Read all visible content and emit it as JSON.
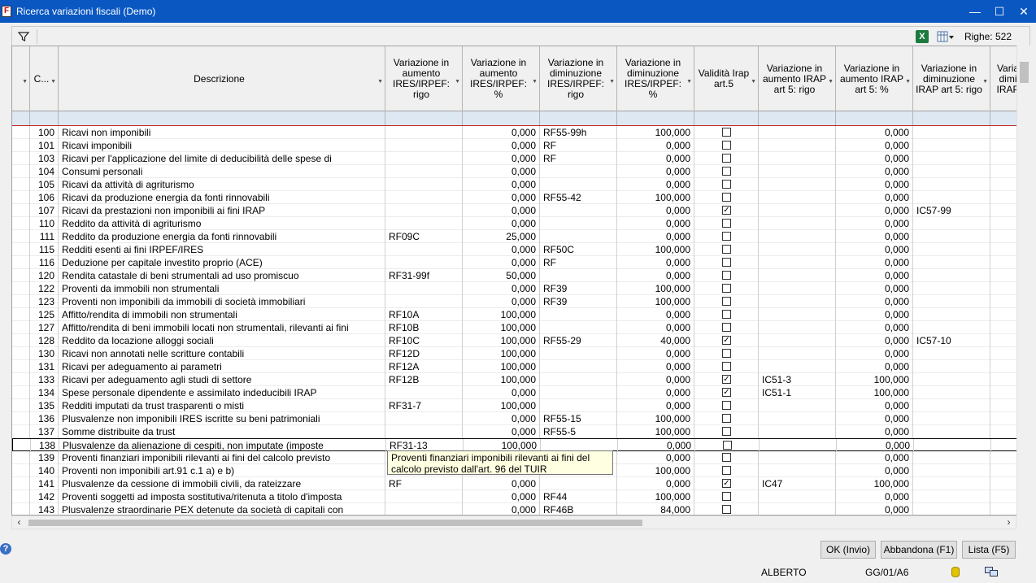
{
  "window": {
    "title": "Ricerca variazioni fiscali  (Demo)",
    "app_icon_glyph": "F"
  },
  "toolbar": {
    "rows_label": "Righe: 522"
  },
  "columns": [
    {
      "key": "sel",
      "label": ""
    },
    {
      "key": "code",
      "label": "C..."
    },
    {
      "key": "desc",
      "label": "Descrizione"
    },
    {
      "key": "va_ires_rigo",
      "label": "Variazione in aumento IRES/IRPEF: rigo"
    },
    {
      "key": "va_ires_pct",
      "label": "Variazione in aumento IRES/IRPEF: %"
    },
    {
      "key": "vd_ires_rigo",
      "label": "Variazione in diminuzione IRES/IRPEF: rigo"
    },
    {
      "key": "vd_ires_pct",
      "label": "Variazione in diminuzione IRES/IRPEF: %"
    },
    {
      "key": "irap",
      "label": "Validità Irap art.5"
    },
    {
      "key": "va_irap_rigo",
      "label": "Variazione in aumento IRAP art 5: rigo"
    },
    {
      "key": "va_irap_pct",
      "label": "Variazione in aumento IRAP art 5: %"
    },
    {
      "key": "vd_irap_rigo",
      "label": "Variazione in diminuzione IRAP art 5: rigo"
    },
    {
      "key": "vd_irap_more",
      "label": "Varia dimi IRAP"
    }
  ],
  "rows": [
    {
      "code": "100",
      "desc": "Ricavi non imponibili",
      "a": "",
      "b": "0,000",
      "c": "RF55-99h",
      "d": "100,000",
      "irap": false,
      "e": "",
      "f": "0,000",
      "g": ""
    },
    {
      "code": "101",
      "desc": "Ricavi imponibili",
      "a": "",
      "b": "0,000",
      "c": "RF",
      "d": "0,000",
      "irap": false,
      "e": "",
      "f": "0,000",
      "g": ""
    },
    {
      "code": "103",
      "desc": "Ricavi per l'applicazione del limite di deducibilità delle spese di",
      "a": "",
      "b": "0,000",
      "c": "RF",
      "d": "0,000",
      "irap": false,
      "e": "",
      "f": "0,000",
      "g": ""
    },
    {
      "code": "104",
      "desc": "Consumi personali",
      "a": "",
      "b": "0,000",
      "c": "",
      "d": "0,000",
      "irap": false,
      "e": "",
      "f": "0,000",
      "g": ""
    },
    {
      "code": "105",
      "desc": "Ricavi da attività di agriturismo",
      "a": "",
      "b": "0,000",
      "c": "",
      "d": "0,000",
      "irap": false,
      "e": "",
      "f": "0,000",
      "g": ""
    },
    {
      "code": "106",
      "desc": "Ricavi da produzione energia da fonti rinnovabili",
      "a": "",
      "b": "0,000",
      "c": "RF55-42",
      "d": "100,000",
      "irap": false,
      "e": "",
      "f": "0,000",
      "g": ""
    },
    {
      "code": "107",
      "desc": "Ricavi da prestazioni non imponibili ai fini IRAP",
      "a": "",
      "b": "0,000",
      "c": "",
      "d": "0,000",
      "irap": true,
      "e": "",
      "f": "0,000",
      "g": "IC57-99"
    },
    {
      "code": "110",
      "desc": "Reddito da attività di agriturismo",
      "a": "",
      "b": "0,000",
      "c": "",
      "d": "0,000",
      "irap": false,
      "e": "",
      "f": "0,000",
      "g": ""
    },
    {
      "code": "111",
      "desc": "Reddito da produzione energia da fonti rinnovabili",
      "a": "RF09C",
      "b": "25,000",
      "c": "",
      "d": "0,000",
      "irap": false,
      "e": "",
      "f": "0,000",
      "g": ""
    },
    {
      "code": "115",
      "desc": "Redditi esenti ai fini IRPEF/IRES",
      "a": "",
      "b": "0,000",
      "c": "RF50C",
      "d": "100,000",
      "irap": false,
      "e": "",
      "f": "0,000",
      "g": ""
    },
    {
      "code": "116",
      "desc": "Deduzione per capitale investito proprio (ACE)",
      "a": "",
      "b": "0,000",
      "c": "RF",
      "d": "0,000",
      "irap": false,
      "e": "",
      "f": "0,000",
      "g": ""
    },
    {
      "code": "120",
      "desc": "Rendita catastale di beni strumentali ad uso promiscuo",
      "a": "RF31-99f",
      "b": "50,000",
      "c": "",
      "d": "0,000",
      "irap": false,
      "e": "",
      "f": "0,000",
      "g": ""
    },
    {
      "code": "122",
      "desc": "Proventi da immobili non strumentali",
      "a": "",
      "b": "0,000",
      "c": "RF39",
      "d": "100,000",
      "irap": false,
      "e": "",
      "f": "0,000",
      "g": ""
    },
    {
      "code": "123",
      "desc": "Proventi non imponibili da immobili di società immobiliari",
      "a": "",
      "b": "0,000",
      "c": "RF39",
      "d": "100,000",
      "irap": false,
      "e": "",
      "f": "0,000",
      "g": ""
    },
    {
      "code": "125",
      "desc": "Affitto/rendita di immobili non strumentali",
      "a": "RF10A",
      "b": "100,000",
      "c": "",
      "d": "0,000",
      "irap": false,
      "e": "",
      "f": "0,000",
      "g": ""
    },
    {
      "code": "127",
      "desc": "Affitto/rendita di beni immobili locati non strumentali, rilevanti ai fini",
      "a": "RF10B",
      "b": "100,000",
      "c": "",
      "d": "0,000",
      "irap": false,
      "e": "",
      "f": "0,000",
      "g": ""
    },
    {
      "code": "128",
      "desc": "Reddito da locazione alloggi sociali",
      "a": "RF10C",
      "b": "100,000",
      "c": "RF55-29",
      "d": "40,000",
      "irap": true,
      "e": "",
      "f": "0,000",
      "g": "IC57-10"
    },
    {
      "code": "130",
      "desc": "Ricavi non annotati nelle scritture contabili",
      "a": "RF12D",
      "b": "100,000",
      "c": "",
      "d": "0,000",
      "irap": false,
      "e": "",
      "f": "0,000",
      "g": ""
    },
    {
      "code": "131",
      "desc": "Ricavi per adeguamento ai parametri",
      "a": "RF12A",
      "b": "100,000",
      "c": "",
      "d": "0,000",
      "irap": false,
      "e": "",
      "f": "0,000",
      "g": ""
    },
    {
      "code": "133",
      "desc": "Ricavi per adeguamento agli studi di settore",
      "a": "RF12B",
      "b": "100,000",
      "c": "",
      "d": "0,000",
      "irap": true,
      "e": "IC51-3",
      "f": "100,000",
      "g": ""
    },
    {
      "code": "134",
      "desc": "Spese personale dipendente e assimilato indeducibili IRAP",
      "a": "",
      "b": "0,000",
      "c": "",
      "d": "0,000",
      "irap": true,
      "e": "IC51-1",
      "f": "100,000",
      "g": ""
    },
    {
      "code": "135",
      "desc": "Redditi imputati da trust trasparenti o misti",
      "a": "RF31-7",
      "b": "100,000",
      "c": "",
      "d": "0,000",
      "irap": false,
      "e": "",
      "f": "0,000",
      "g": ""
    },
    {
      "code": "136",
      "desc": "Plusvalenze non imponibili IRES iscritte su beni patrimoniali",
      "a": "",
      "b": "0,000",
      "c": "RF55-15",
      "d": "100,000",
      "irap": false,
      "e": "",
      "f": "0,000",
      "g": ""
    },
    {
      "code": "137",
      "desc": "Somme distribuite da trust",
      "a": "",
      "b": "0,000",
      "c": "RF55-5",
      "d": "100,000",
      "irap": false,
      "e": "",
      "f": "0,000",
      "g": ""
    },
    {
      "code": "138",
      "desc": "Plusvalenze da alienazione di cespiti, non imputate (imposte",
      "a": "RF31-13",
      "b": "100,000",
      "c": "",
      "d": "0,000",
      "irap": false,
      "e": "",
      "f": "0,000",
      "g": "",
      "selected": true
    },
    {
      "code": "139",
      "desc": "Proventi finanziari imponibili rilevanti ai fini del calcolo previsto",
      "a": "",
      "b": "",
      "c": "",
      "d": "0,000",
      "irap": false,
      "e": "",
      "f": "0,000",
      "g": ""
    },
    {
      "code": "140",
      "desc": "Proventi non imponibili art.91 c.1 a) e b)",
      "a": "",
      "b": "",
      "c": "",
      "d": "100,000",
      "irap": false,
      "e": "",
      "f": "0,000",
      "g": ""
    },
    {
      "code": "141",
      "desc": "Plusvalenze da cessione di immobili civili, da rateizzare",
      "a": "RF",
      "b": "0,000",
      "c": "",
      "d": "0,000",
      "irap": true,
      "e": "IC47",
      "f": "100,000",
      "g": ""
    },
    {
      "code": "142",
      "desc": "Proventi soggetti ad imposta sostitutiva/ritenuta a titolo d'imposta",
      "a": "",
      "b": "0,000",
      "c": "RF44",
      "d": "100,000",
      "irap": false,
      "e": "",
      "f": "0,000",
      "g": ""
    },
    {
      "code": "143",
      "desc": "Plusvalenze straordinarie PEX detenute da società di capitali con",
      "a": "",
      "b": "0,000",
      "c": "RF46B",
      "d": "84,000",
      "irap": false,
      "e": "",
      "f": "0,000",
      "g": ""
    }
  ],
  "tooltip": {
    "line1": "Proventi finanziari imponibili rilevanti ai fini del",
    "line2": "calcolo previsto dall'art. 96 del TUIR"
  },
  "buttons": {
    "ok": "OK (Invio)",
    "abandon": "Abbandona (F1)",
    "list": "Lista (F5)"
  },
  "status": {
    "user": "ALBERTO",
    "date": "GG/01/A6"
  },
  "colors": {
    "titlebar": "#0a57c2",
    "filter_row": "#dde8f3",
    "tooltip_bg": "#ffffe1"
  }
}
